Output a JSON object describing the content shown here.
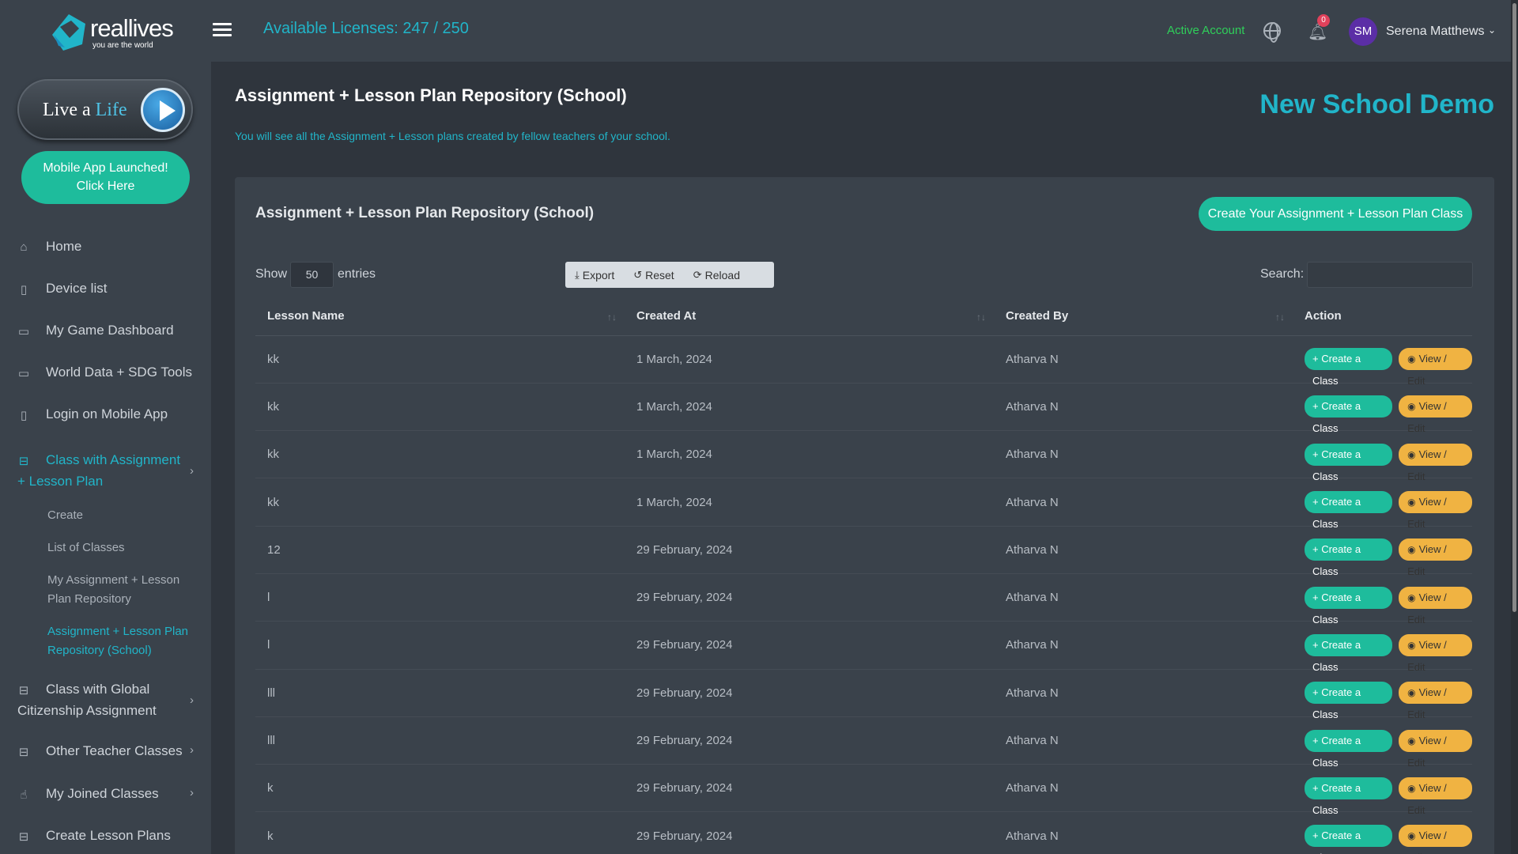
{
  "brand": {
    "name_part1": "real",
    "name_part2": "lives",
    "tagline": "you are the world"
  },
  "sidebar": {
    "live_btn": {
      "text_a": "Live a",
      "text_b": "Life"
    },
    "mobile_btn": {
      "line1": "Mobile App Launched!",
      "line2": "Click Here"
    },
    "items": [
      {
        "label": "Home",
        "icon": "home-icon"
      },
      {
        "label": "Device list",
        "icon": "mobile-icon"
      },
      {
        "label": "My Game Dashboard",
        "icon": "monitor-icon"
      },
      {
        "label": "World Data + SDG Tools",
        "icon": "monitor-icon"
      },
      {
        "label": "Login on Mobile App",
        "icon": "mobile-icon"
      },
      {
        "label": "Class with Assignment + Lesson Plan",
        "icon": "book-icon"
      },
      {
        "label": "Class with Global Citizenship Assignment",
        "icon": "book-icon"
      },
      {
        "label": "Other Teacher Classes",
        "icon": "book-icon"
      },
      {
        "label": "My Joined Classes",
        "icon": "thumbs-up-icon"
      },
      {
        "label": "Create Lesson Plans",
        "icon": "book-icon"
      }
    ],
    "subitems": [
      {
        "label": "Create"
      },
      {
        "label": "List of Classes"
      },
      {
        "label": "My Assignment + Lesson Plan Repository"
      },
      {
        "label": "Assignment + Lesson Plan Repository (School)"
      }
    ]
  },
  "topbar": {
    "licenses": "Available Licenses: 247 / 250",
    "active_account": "Active Account",
    "notif_count": "0",
    "avatar_initials": "SM",
    "username": "Serena Matthews"
  },
  "page": {
    "title": "Assignment + Lesson Plan Repository (School)",
    "subtitle": "You will see all the Assignment + Lesson plans created by fellow teachers of your school.",
    "school": "New School Demo"
  },
  "card": {
    "title": "Assignment + Lesson Plan Repository (School)",
    "create_btn": "Create Your Assignment + Lesson Plan Class",
    "show": "Show",
    "entries_value": "50",
    "entries": "entries",
    "tools": [
      "Export",
      "Reset",
      "Reload"
    ],
    "search": "Search:"
  },
  "table": {
    "headers": [
      "Lesson Name",
      "Created At",
      "Created By",
      "Action"
    ],
    "create_label": "Create a Class",
    "view_label": "View / Edit",
    "rows": [
      {
        "name": "kk",
        "created_at": "1 March, 2024",
        "created_by": "Atharva N"
      },
      {
        "name": "kk",
        "created_at": "1 March, 2024",
        "created_by": "Atharva N"
      },
      {
        "name": "kk",
        "created_at": "1 March, 2024",
        "created_by": "Atharva N"
      },
      {
        "name": "kk",
        "created_at": "1 March, 2024",
        "created_by": "Atharva N"
      },
      {
        "name": "12",
        "created_at": "29 February, 2024",
        "created_by": "Atharva N"
      },
      {
        "name": "l",
        "created_at": "29 February, 2024",
        "created_by": "Atharva N"
      },
      {
        "name": "l",
        "created_at": "29 February, 2024",
        "created_by": "Atharva N"
      },
      {
        "name": "lll",
        "created_at": "29 February, 2024",
        "created_by": "Atharva N"
      },
      {
        "name": "lll",
        "created_at": "29 February, 2024",
        "created_by": "Atharva N"
      },
      {
        "name": "k",
        "created_at": "29 February, 2024",
        "created_by": "Atharva N"
      },
      {
        "name": "k",
        "created_at": "29 February, 2024",
        "created_by": "Atharva N"
      }
    ]
  },
  "colors": {
    "accent": "#21b5c9",
    "green": "#1ebc9c",
    "orange": "#f0b342",
    "bg": "#2f353d",
    "panel": "#3a424b"
  }
}
